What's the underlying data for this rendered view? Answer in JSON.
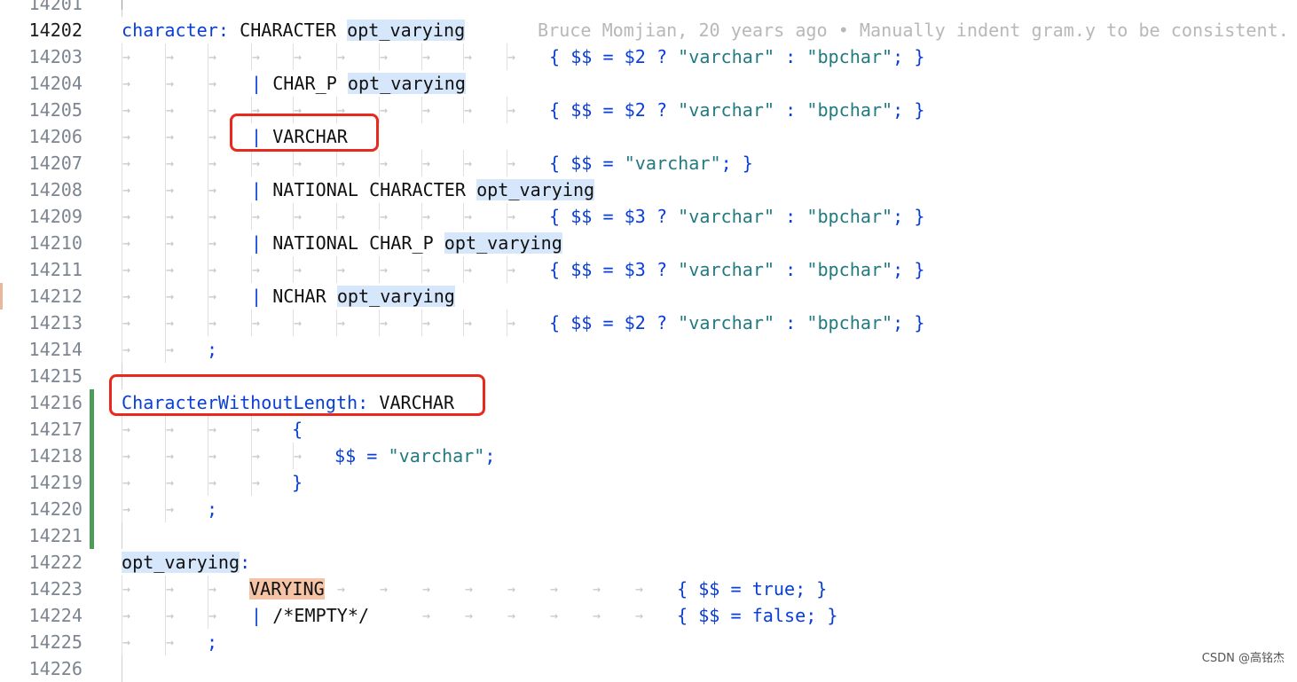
{
  "editor": {
    "lines": [
      {
        "n": "14201",
        "segs": []
      },
      {
        "n": "14202",
        "active": true,
        "segs": [
          {
            "t": "character:",
            "c": "kw"
          },
          {
            "t": " "
          },
          {
            "t": "CHARACTER"
          },
          {
            "t": " "
          },
          {
            "t": "opt_varying",
            "c": "hl"
          }
        ],
        "blame": "Bruce Momjian, 20 years ago • Manually indent gram.y to be consistent."
      },
      {
        "n": "14203",
        "segs": [
          {
            "t": "{ $$ = $2 ? ",
            "c": "kw"
          },
          {
            "t": "\"varchar\"",
            "c": "str"
          },
          {
            "t": " : ",
            "c": "kw"
          },
          {
            "t": "\"bpchar\"",
            "c": "str"
          },
          {
            "t": "; }",
            "c": "kw"
          }
        ]
      },
      {
        "n": "14204",
        "segs": [
          {
            "t": "| ",
            "c": "kw"
          },
          {
            "t": "CHAR_P"
          },
          {
            "t": " "
          },
          {
            "t": "opt_varying",
            "c": "hl"
          }
        ]
      },
      {
        "n": "14205",
        "segs": [
          {
            "t": "{ $$ = $2 ? ",
            "c": "kw"
          },
          {
            "t": "\"varchar\"",
            "c": "str"
          },
          {
            "t": " : ",
            "c": "kw"
          },
          {
            "t": "\"bpchar\"",
            "c": "str"
          },
          {
            "t": "; }",
            "c": "kw"
          }
        ]
      },
      {
        "n": "14206",
        "segs": [
          {
            "t": "| ",
            "c": "kw"
          },
          {
            "t": "VARCHAR"
          }
        ]
      },
      {
        "n": "14207",
        "segs": [
          {
            "t": "{ $$ = ",
            "c": "kw"
          },
          {
            "t": "\"varchar\"",
            "c": "str"
          },
          {
            "t": "; }",
            "c": "kw"
          }
        ]
      },
      {
        "n": "14208",
        "segs": [
          {
            "t": "| ",
            "c": "kw"
          },
          {
            "t": "NATIONAL CHARACTER"
          },
          {
            "t": " "
          },
          {
            "t": "opt_varying",
            "c": "hl"
          }
        ]
      },
      {
        "n": "14209",
        "segs": [
          {
            "t": "{ $$ = $3 ? ",
            "c": "kw"
          },
          {
            "t": "\"varchar\"",
            "c": "str"
          },
          {
            "t": " : ",
            "c": "kw"
          },
          {
            "t": "\"bpchar\"",
            "c": "str"
          },
          {
            "t": "; }",
            "c": "kw"
          }
        ]
      },
      {
        "n": "14210",
        "segs": [
          {
            "t": "| ",
            "c": "kw"
          },
          {
            "t": "NATIONAL CHAR_P"
          },
          {
            "t": " "
          },
          {
            "t": "opt_varying",
            "c": "hl"
          }
        ]
      },
      {
        "n": "14211",
        "segs": [
          {
            "t": "{ $$ = $3 ? ",
            "c": "kw"
          },
          {
            "t": "\"varchar\"",
            "c": "str"
          },
          {
            "t": " : ",
            "c": "kw"
          },
          {
            "t": "\"bpchar\"",
            "c": "str"
          },
          {
            "t": "; }",
            "c": "kw"
          }
        ]
      },
      {
        "n": "14212",
        "segs": [
          {
            "t": "| ",
            "c": "kw"
          },
          {
            "t": "NCHAR"
          },
          {
            "t": " "
          },
          {
            "t": "opt_varying",
            "c": "hl"
          }
        ]
      },
      {
        "n": "14213",
        "segs": [
          {
            "t": "{ $$ = $2 ? ",
            "c": "kw"
          },
          {
            "t": "\"varchar\"",
            "c": "str"
          },
          {
            "t": " : ",
            "c": "kw"
          },
          {
            "t": "\"bpchar\"",
            "c": "str"
          },
          {
            "t": "; }",
            "c": "kw"
          }
        ]
      },
      {
        "n": "14214",
        "segs": [
          {
            "t": ";",
            "c": "kw"
          }
        ]
      },
      {
        "n": "14215",
        "segs": []
      },
      {
        "n": "14216",
        "segs": [
          {
            "t": "CharacterWithoutLength:",
            "c": "kw"
          },
          {
            "t": " "
          },
          {
            "t": "VARCHAR"
          }
        ]
      },
      {
        "n": "14217",
        "segs": [
          {
            "t": "{",
            "c": "kw"
          }
        ]
      },
      {
        "n": "14218",
        "segs": [
          {
            "t": "$$ = ",
            "c": "kw"
          },
          {
            "t": "\"varchar\"",
            "c": "str"
          },
          {
            "t": ";",
            "c": "kw"
          }
        ]
      },
      {
        "n": "14219",
        "segs": [
          {
            "t": "}",
            "c": "kw"
          }
        ]
      },
      {
        "n": "14220",
        "segs": [
          {
            "t": ";",
            "c": "kw"
          }
        ]
      },
      {
        "n": "14221",
        "segs": []
      },
      {
        "n": "14222",
        "segs": [
          {
            "t": "opt_varying",
            "c": "hl"
          },
          {
            "t": ":",
            "c": "kw"
          }
        ]
      },
      {
        "n": "14223",
        "segs": [
          {
            "t": "VARYING",
            "c": "hl2"
          }
        ]
      },
      {
        "n": "14224",
        "segs": [
          {
            "t": "| ",
            "c": "kw"
          },
          {
            "t": "/*EMPTY*/"
          }
        ]
      },
      {
        "n": "14225",
        "segs": [
          {
            "t": ";",
            "c": "kw"
          }
        ]
      },
      {
        "n": "14226",
        "segs": []
      }
    ],
    "trailing": {
      "14223": [
        {
          "t": "{ $$ = ",
          "c": "kw"
        },
        {
          "t": "true",
          "c": "kw"
        },
        {
          "t": "; }",
          "c": "kw"
        }
      ],
      "14224": [
        {
          "t": "{ $$ = ",
          "c": "kw"
        },
        {
          "t": "false",
          "c": "kw"
        },
        {
          "t": "; }",
          "c": "kw"
        }
      ]
    }
  },
  "watermark": "CSDN @高铭杰",
  "colors": {
    "keyword": "#0a3fd6",
    "string": "#227a80",
    "highlight": "#d7e7fb",
    "match": "#f5c3a6",
    "annotation_box": "#e8291c",
    "change_bar": "#4e9c5a"
  }
}
